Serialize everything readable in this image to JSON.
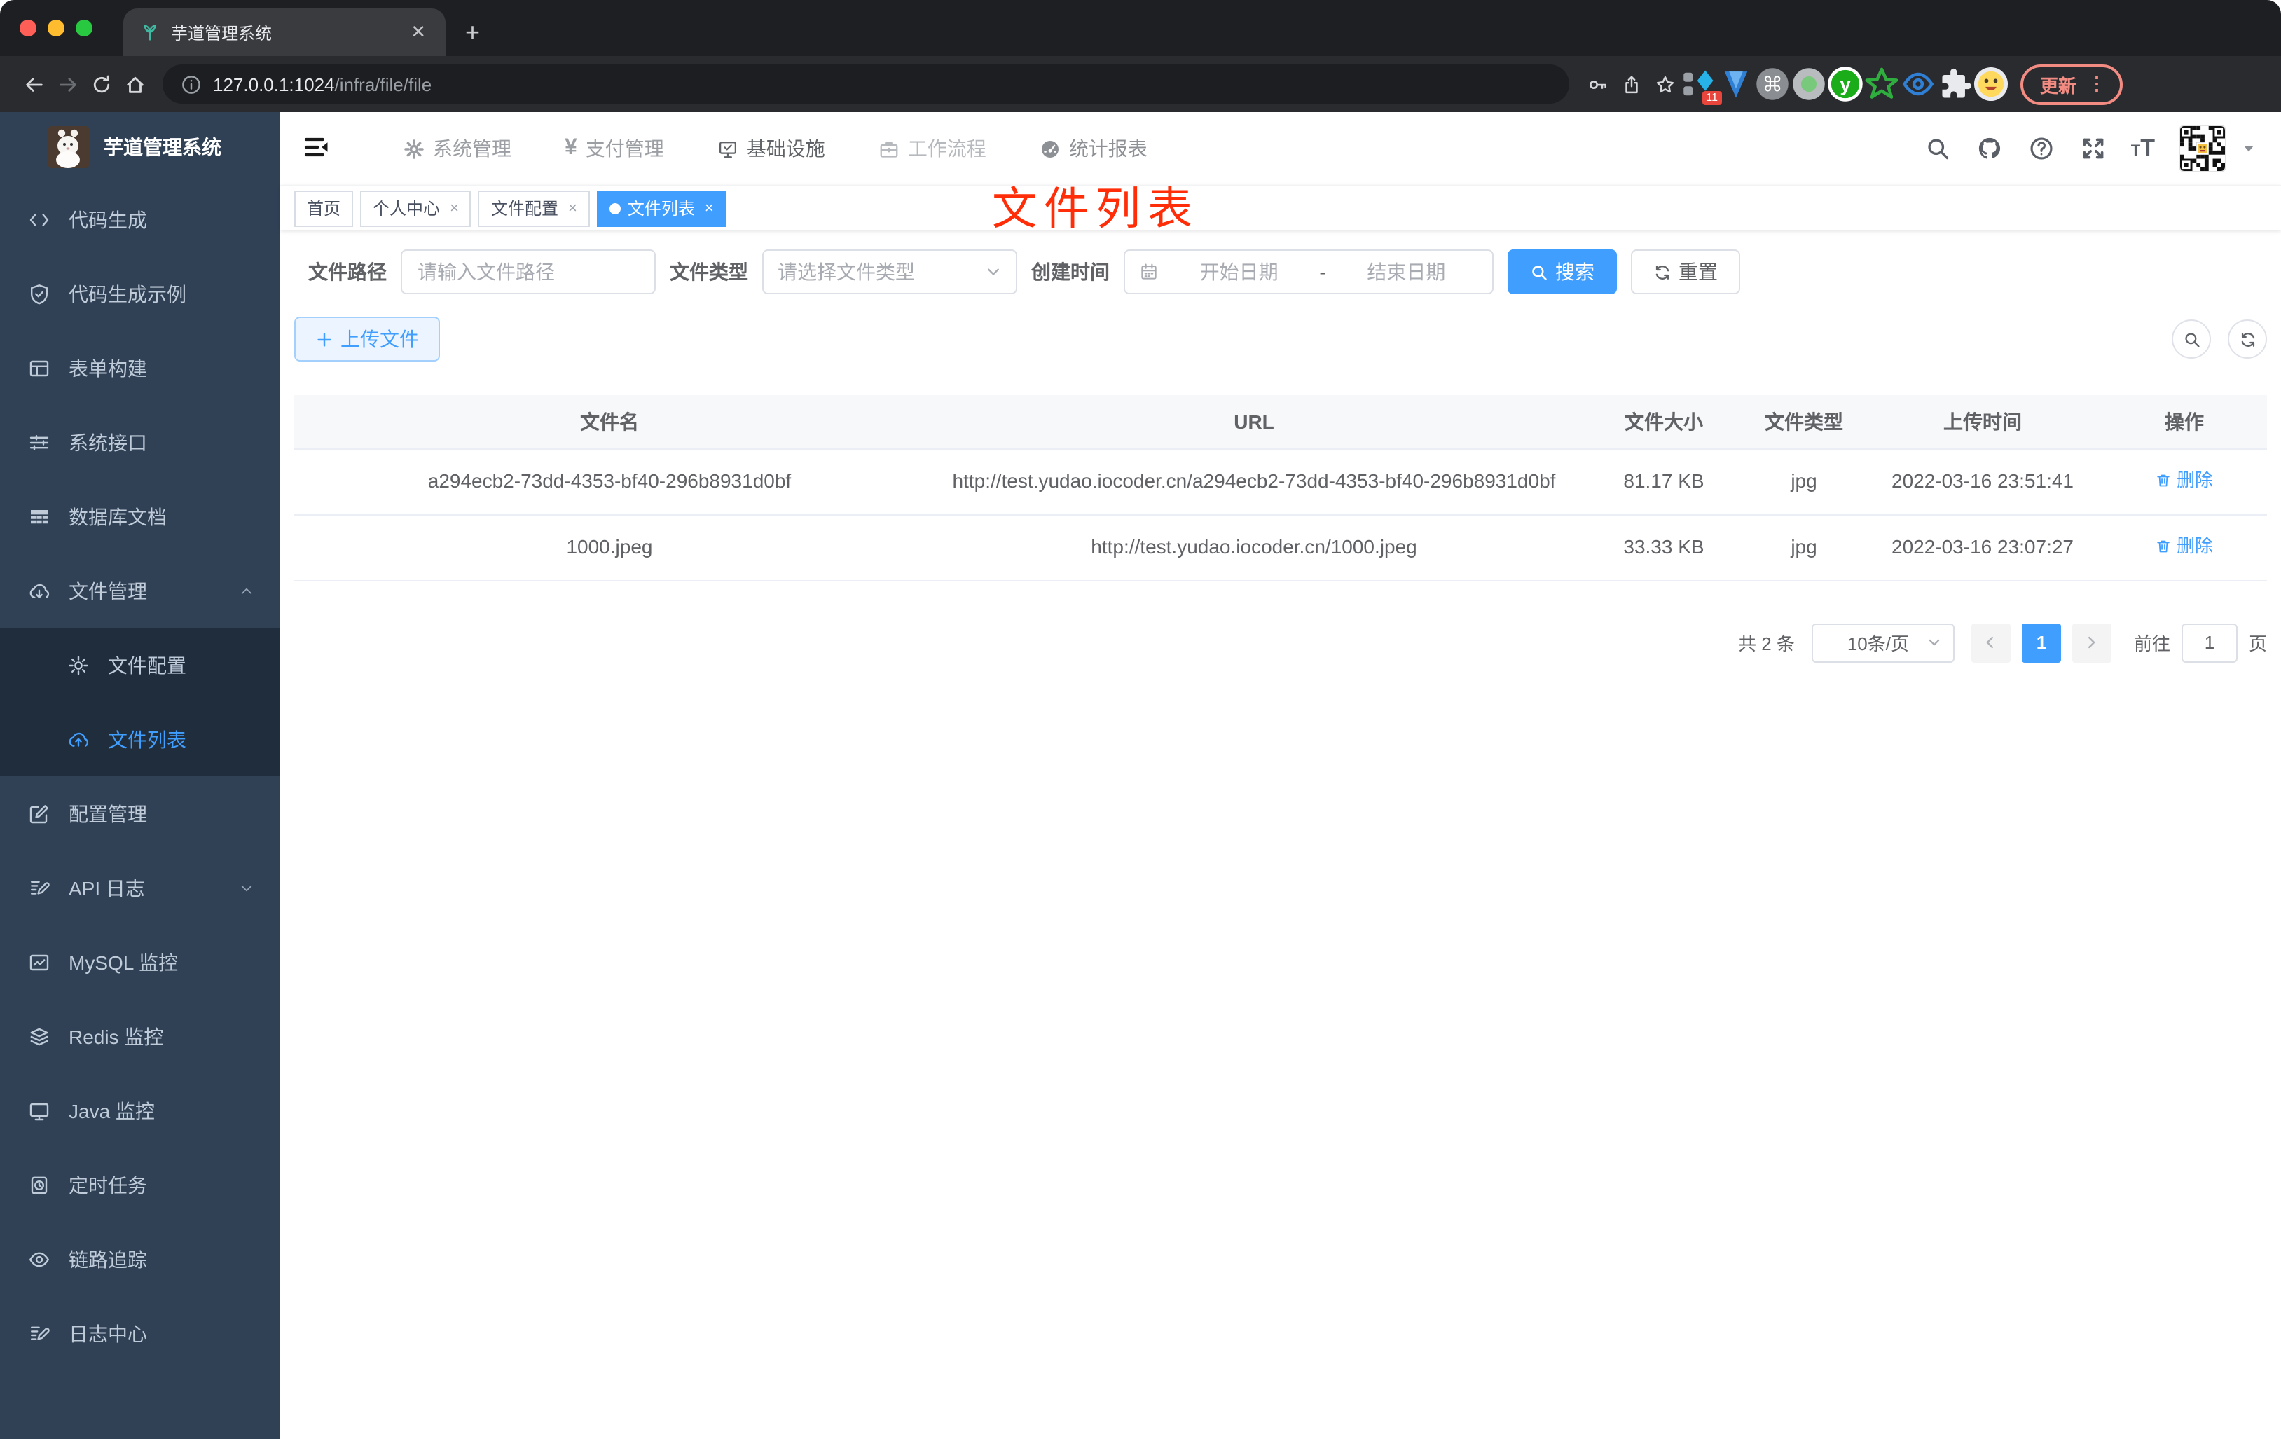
{
  "colors": {
    "accent": "#409eff",
    "annotation": "#ff2d08",
    "sidebar_bg": "#304156",
    "submenu_bg": "#1f2d3d"
  },
  "browser": {
    "tab_title": "芋道管理系统",
    "url_host": "127.0.0.1:1024",
    "url_path": "/infra/file/file",
    "update_button": "更新",
    "extension_badge": "11"
  },
  "sidebar": {
    "title": "芋道管理系统",
    "items": [
      {
        "icon": "code-icon",
        "label": "代码生成"
      },
      {
        "icon": "shield-check-icon",
        "label": "代码生成示例"
      },
      {
        "icon": "form-icon",
        "label": "表单构建"
      },
      {
        "icon": "sliders-icon",
        "label": "系统接口"
      },
      {
        "icon": "table-icon",
        "label": "数据库文档"
      },
      {
        "icon": "cloud-download-icon",
        "label": "文件管理",
        "expanded": true,
        "children": [
          {
            "icon": "gear-icon",
            "label": "文件配置"
          },
          {
            "icon": "cloud-upload-icon",
            "label": "文件列表",
            "active": true
          }
        ]
      },
      {
        "icon": "edit-icon",
        "label": "配置管理"
      },
      {
        "icon": "document-edit-icon",
        "label": "API 日志",
        "collapsible": true
      },
      {
        "icon": "chart-icon",
        "label": "MySQL 监控"
      },
      {
        "icon": "layers-icon",
        "label": "Redis 监控"
      },
      {
        "icon": "monitor-icon",
        "label": "Java 监控"
      },
      {
        "icon": "schedule-icon",
        "label": "定时任务"
      },
      {
        "icon": "eye-icon",
        "label": "链路追踪"
      },
      {
        "icon": "document-edit-icon",
        "label": "日志中心"
      }
    ]
  },
  "navbar": {
    "menus": [
      {
        "icon": "gear-filled-icon",
        "label": "系统管理",
        "tone": ""
      },
      {
        "icon": "yen-icon",
        "label": "支付管理",
        "tone": ""
      },
      {
        "icon": "monitor-check-icon",
        "label": "基础设施",
        "tone": "nav-active"
      },
      {
        "icon": "briefcase-icon",
        "label": "工作流程",
        "tone": "nav-light"
      },
      {
        "icon": "gauge-icon",
        "label": "统计报表",
        "tone": "nav-mid"
      }
    ]
  },
  "tags": [
    {
      "label": "首页",
      "closable": false,
      "active": false
    },
    {
      "label": "个人中心",
      "closable": true,
      "active": false
    },
    {
      "label": "文件配置",
      "closable": true,
      "active": false
    },
    {
      "label": "文件列表",
      "closable": true,
      "active": true
    }
  ],
  "annotation": "文件列表",
  "filters": {
    "path_label": "文件路径",
    "path_placeholder": "请输入文件路径",
    "type_label": "文件类型",
    "type_placeholder": "请选择文件类型",
    "date_label": "创建时间",
    "date_start_placeholder": "开始日期",
    "date_separator": "-",
    "date_end_placeholder": "结束日期",
    "search_label": "搜索",
    "reset_label": "重置"
  },
  "toolbar": {
    "upload_label": "上传文件"
  },
  "table": {
    "columns": [
      "文件名",
      "URL",
      "文件大小",
      "文件类型",
      "上传时间",
      "操作"
    ],
    "rows": [
      {
        "name": "a294ecb2-73dd-4353-bf40-296b8931d0bf",
        "url": "http://test.yudao.iocoder.cn/a294ecb2-73dd-4353-bf40-296b8931d0bf",
        "size": "81.17 KB",
        "type": "jpg",
        "time": "2022-03-16 23:51:41",
        "action": "删除"
      },
      {
        "name": "1000.jpeg",
        "url": "http://test.yudao.iocoder.cn/1000.jpeg",
        "size": "33.33 KB",
        "type": "jpg",
        "time": "2022-03-16 23:07:27",
        "action": "删除"
      }
    ]
  },
  "pagination": {
    "total_label": "共 2 条",
    "page_size": "10条/页",
    "current_page": "1",
    "goto_label": "前往",
    "goto_value": "1",
    "goto_suffix": "页"
  }
}
